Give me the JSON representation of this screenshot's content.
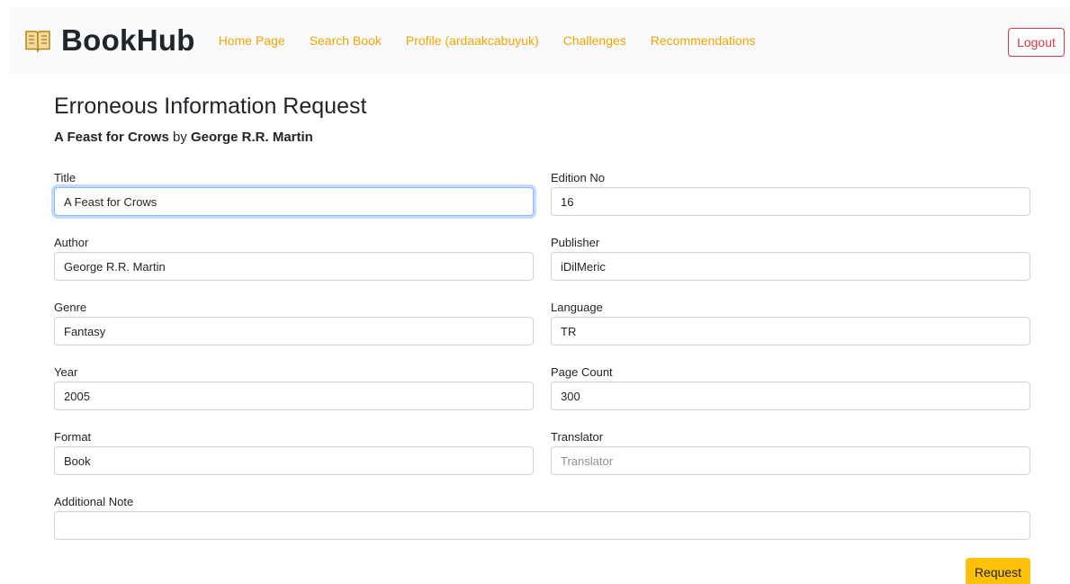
{
  "brand": {
    "name": "BookHub",
    "icon": "open-book-icon",
    "icon_color": "#d4a017"
  },
  "nav": {
    "links": [
      {
        "label": "Home Page"
      },
      {
        "label": "Search Book"
      },
      {
        "label": "Profile (ardaakcabuyuk)"
      },
      {
        "label": "Challenges"
      },
      {
        "label": "Recommendations"
      }
    ],
    "logout_label": "Logout"
  },
  "page": {
    "title": "Erroneous Information Request",
    "book_title": "A Feast for Crows",
    "by_word": "by",
    "book_author": "George R.R. Martin"
  },
  "form": {
    "title": {
      "label": "Title",
      "value": "A Feast for Crows"
    },
    "edition_no": {
      "label": "Edition No",
      "value": "16"
    },
    "author": {
      "label": "Author",
      "value": "George R.R. Martin"
    },
    "publisher": {
      "label": "Publisher",
      "value": "iDilMeric"
    },
    "genre": {
      "label": "Genre",
      "value": "Fantasy"
    },
    "language": {
      "label": "Language",
      "value": "TR"
    },
    "year": {
      "label": "Year",
      "value": "2005"
    },
    "page_count": {
      "label": "Page Count",
      "value": "300"
    },
    "format": {
      "label": "Format",
      "value": "Book"
    },
    "translator": {
      "label": "Translator",
      "value": "",
      "placeholder": "Translator"
    },
    "additional_note": {
      "label": "Additional Note",
      "value": ""
    },
    "submit_label": "Request"
  },
  "colors": {
    "accent": "#f0a500",
    "logout": "#dc3545",
    "submit": "#ffc107",
    "navbar_bg": "#f8f9fa"
  }
}
